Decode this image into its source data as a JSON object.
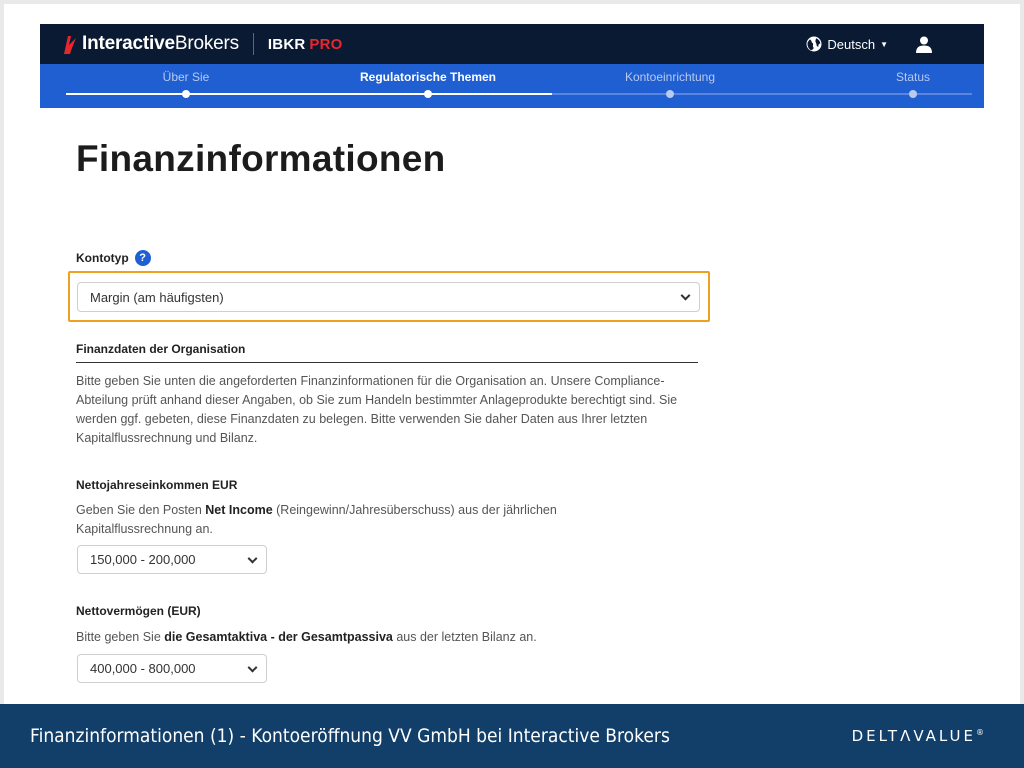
{
  "header": {
    "logo_bold": "Interactive",
    "logo_regular": "Brokers",
    "product_name": "IBKR",
    "product_suffix": "PRO",
    "language": "Deutsch",
    "brand_color": "#e8262d"
  },
  "steps": [
    {
      "label": "Über Sie",
      "state": "done"
    },
    {
      "label": "Regulatorische Themen",
      "state": "active"
    },
    {
      "label": "Kontoeinrichtung",
      "state": "todo"
    },
    {
      "label": "Status",
      "state": "todo"
    }
  ],
  "main": {
    "title": "Finanzinformationen",
    "account_type_label": "Kontotyp",
    "help_glyph": "?",
    "account_type_value": "Margin (am häufigsten)",
    "org_section_title": "Finanzdaten der Organisation",
    "org_intro": "Bitte geben Sie unten die angeforderten Finanzinformationen für die Organisation an. Unsere Compliance-Abteilung prüft anhand dieser Angaben, ob Sie zum Handeln bestimmter Anlageprodukte berechtigt sind. Sie werden ggf. gebeten, diese Finanzdaten zu belegen. Bitte verwenden Sie daher Daten aus Ihrer letzten Kapitalflussrechnung und Bilanz.",
    "income_label": "Nettojahreseinkommen EUR",
    "income_help_pre": "Geben Sie den Posten ",
    "income_help_bold": "Net Income",
    "income_help_post": " (Reingewinn/Jahresüberschuss) aus der jährlichen Kapitalflussrechnung an.",
    "income_value": "150,000 - 200,000",
    "networth_label": "Nettovermögen (EUR)",
    "networth_help_pre": "Bitte geben Sie ",
    "networth_help_bold": "die Gesamtaktiva - der Gesamtpassiva",
    "networth_help_post": " aus der letzten Bilanz an.",
    "networth_value": "400,000 - 800,000"
  },
  "footer": {
    "caption": "Finanzinformationen (1) - Kontoeröffnung VV GmbH bei Interactive Brokers",
    "logo_pre": "DELT",
    "logo_mid": "Λ",
    "logo_post": "VALUE",
    "logo_mark": "®"
  },
  "colors": {
    "topbar": "#0a1a33",
    "stepbar": "#1f5fd1",
    "highlight": "#f0a020",
    "footer": "#123f6a"
  }
}
